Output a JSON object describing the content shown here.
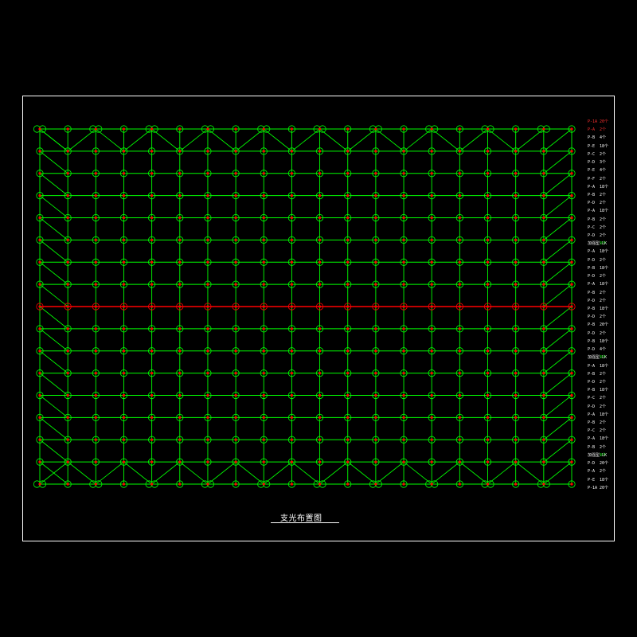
{
  "drawing": {
    "title": "支光布置图",
    "colors": {
      "background": "#000000",
      "frame": "#ffffff",
      "grid_line": "#00ff00",
      "node_ring": "#00ff00",
      "node_dot": "#ff0000",
      "highlight_row": "#ff0000",
      "legend_text": "#ffffff",
      "legend_highlight": "#ff3030",
      "legend_qty_accent": "#00ff00"
    },
    "grid": {
      "columns": 20,
      "rows": 17,
      "highlight_row_index": 8,
      "double_ring_nodes_top_bottom": true
    }
  },
  "legend": [
    {
      "code": "P-1A",
      "qty": "20个",
      "highlight": true
    },
    {
      "code": "P-A",
      "qty": "2个",
      "highlight": true
    },
    {
      "code": "P-B",
      "qty": "4个"
    },
    {
      "code": "P-E",
      "qty": "18个"
    },
    {
      "code": "P-C",
      "qty": "2个"
    },
    {
      "code": "P-D",
      "qty": "3个"
    },
    {
      "code": "P-E",
      "qty": "4个"
    },
    {
      "code": "P-F",
      "qty": "2个"
    },
    {
      "code": "P-A",
      "qty": "18个"
    },
    {
      "code": "P-B",
      "qty": "2个"
    },
    {
      "code": "P-D",
      "qty": "2个"
    },
    {
      "code": "P-A",
      "qty": "18个"
    },
    {
      "code": "P-B",
      "qty": "2个"
    },
    {
      "code": "P-C",
      "qty": "2个"
    },
    {
      "code": "P-D",
      "qty": "2个"
    },
    {
      "code": "加强型-LK",
      "qty": "3个",
      "accent": true
    },
    {
      "code": "P-A",
      "qty": "18个"
    },
    {
      "code": "P-D",
      "qty": "2个"
    },
    {
      "code": "P-B",
      "qty": "18个"
    },
    {
      "code": "P-D",
      "qty": "2个"
    },
    {
      "code": "P-A",
      "qty": "18个"
    },
    {
      "code": "P-B",
      "qty": "2个"
    },
    {
      "code": "P-D",
      "qty": "2个"
    },
    {
      "code": "P-B",
      "qty": "18个"
    },
    {
      "code": "P-D",
      "qty": "2个"
    },
    {
      "code": "P-B",
      "qty": "20个"
    },
    {
      "code": "P-D",
      "qty": "2个"
    },
    {
      "code": "P-B",
      "qty": "18个"
    },
    {
      "code": "P-D",
      "qty": "4个"
    },
    {
      "code": "加强型-LK",
      "qty": "3个",
      "accent": true
    },
    {
      "code": "P-A",
      "qty": "18个"
    },
    {
      "code": "P-B",
      "qty": "2个"
    },
    {
      "code": "P-D",
      "qty": "2个"
    },
    {
      "code": "P-B",
      "qty": "18个"
    },
    {
      "code": "P-C",
      "qty": "2个"
    },
    {
      "code": "P-D",
      "qty": "2个"
    },
    {
      "code": "P-A",
      "qty": "18个"
    },
    {
      "code": "P-B",
      "qty": "2个"
    },
    {
      "code": "P-C",
      "qty": "2个"
    },
    {
      "code": "P-A",
      "qty": "18个"
    },
    {
      "code": "P-B",
      "qty": "2个"
    },
    {
      "code": "加强型-LK",
      "qty": "3个",
      "accent": true
    },
    {
      "code": "P-D",
      "qty": "20个"
    },
    {
      "code": "P-A",
      "qty": "2个"
    },
    {
      "code": "P-E",
      "qty": "18个"
    },
    {
      "code": "P-1A",
      "qty": "20个"
    }
  ]
}
